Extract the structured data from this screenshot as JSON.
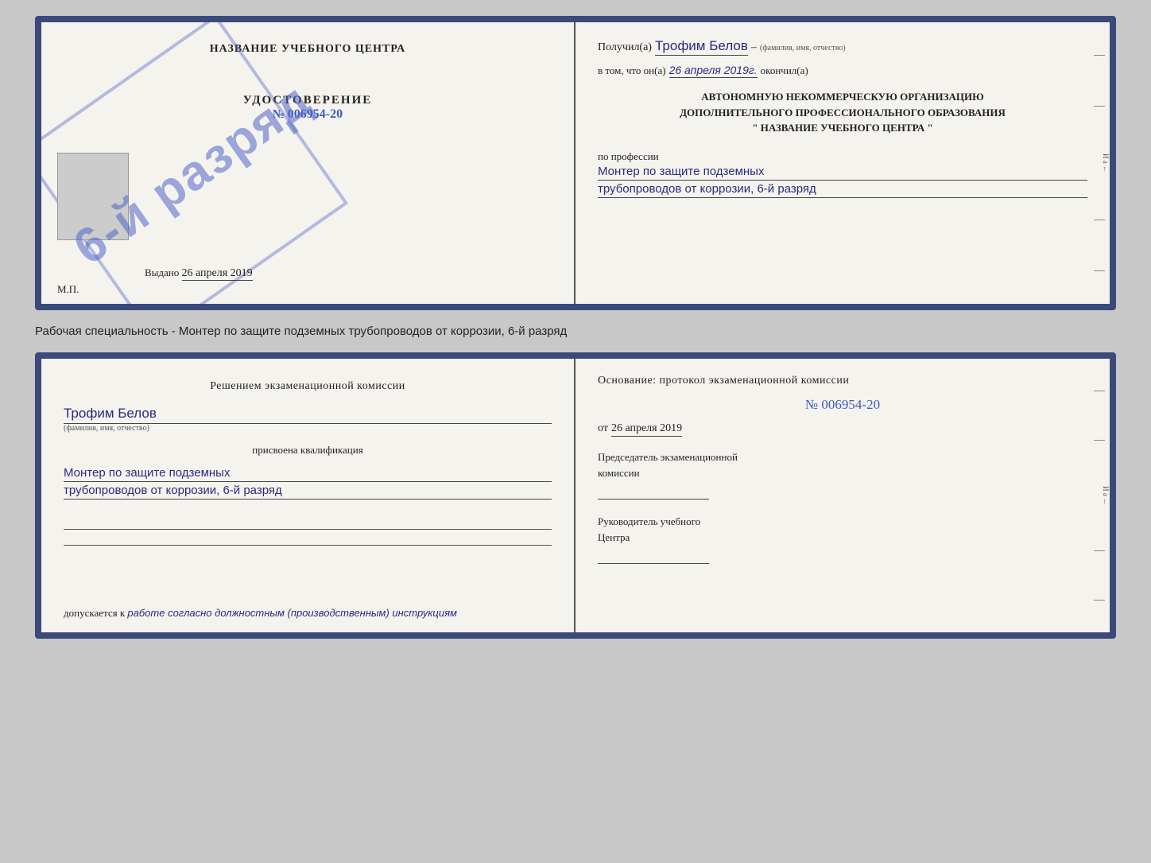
{
  "top_cert": {
    "left": {
      "title": "НАЗВАНИЕ УЧЕБНОГО ЦЕНТРА",
      "stamp_text": "6-й разряд",
      "udostoverenie": "УДОСТОВЕРЕНИЕ",
      "number_label": "№",
      "number_value": "006954-20",
      "vydano_label": "Выдано",
      "vydano_date": "26 апреля 2019",
      "mp": "М.П."
    },
    "right": {
      "poluchil_label": "Получил(а)",
      "fio_value": "Трофим Белов",
      "fio_sub": "(фамилия, имя, отчество)",
      "dash1": "–",
      "vtom_label": "в том, что он(а)",
      "date_value": "26 апреля 2019г.",
      "okochil_label": "окончил(а)",
      "org_line1": "АВТОНОМНУЮ НЕКОММЕРЧЕСКУЮ ОРГАНИЗАЦИЮ",
      "org_line2": "ДОПОЛНИТЕЛЬНОГО ПРОФЕССИОНАЛЬНОГО ОБРАЗОВАНИЯ",
      "org_line3": "\" НАЗВАНИЕ УЧЕБНОГО ЦЕНТРА \"",
      "po_professii": "по профессии",
      "prof_line1": "Монтер по защите подземных",
      "prof_line2": "трубопроводов от коррозии, 6-й разряд",
      "side_label": "И а ←"
    }
  },
  "specialty_label": "Рабочая специальность - Монтер по защите подземных трубопроводов от коррозии, 6-й разряд",
  "bottom_cert": {
    "left": {
      "reshenie": "Решением экзаменационной комиссии",
      "fio_value": "Трофим Белов",
      "fio_sub": "(фамилия, имя, отчество)",
      "prisvoena": "присвоена квалификация",
      "qual_line1": "Монтер по защите подземных",
      "qual_line2": "трубопроводов от коррозии, 6-й разряд",
      "dopuskaetsya_label": "допускается к",
      "dopuskaetsya_value": "работе согласно должностным (производственным) инструкциям"
    },
    "right": {
      "osnovanie": "Основание: протокол экзаменационной комиссии",
      "number_label": "№",
      "number_value": "006954-20",
      "ot_label": "от",
      "ot_date": "26 апреля 2019",
      "predsedatel_line1": "Председатель экзаменационной",
      "predsedatel_line2": "комиссии",
      "rukovoditel_line1": "Руководитель учебного",
      "rukovoditel_line2": "Центра",
      "side_label": "– – И а ← – –"
    }
  }
}
